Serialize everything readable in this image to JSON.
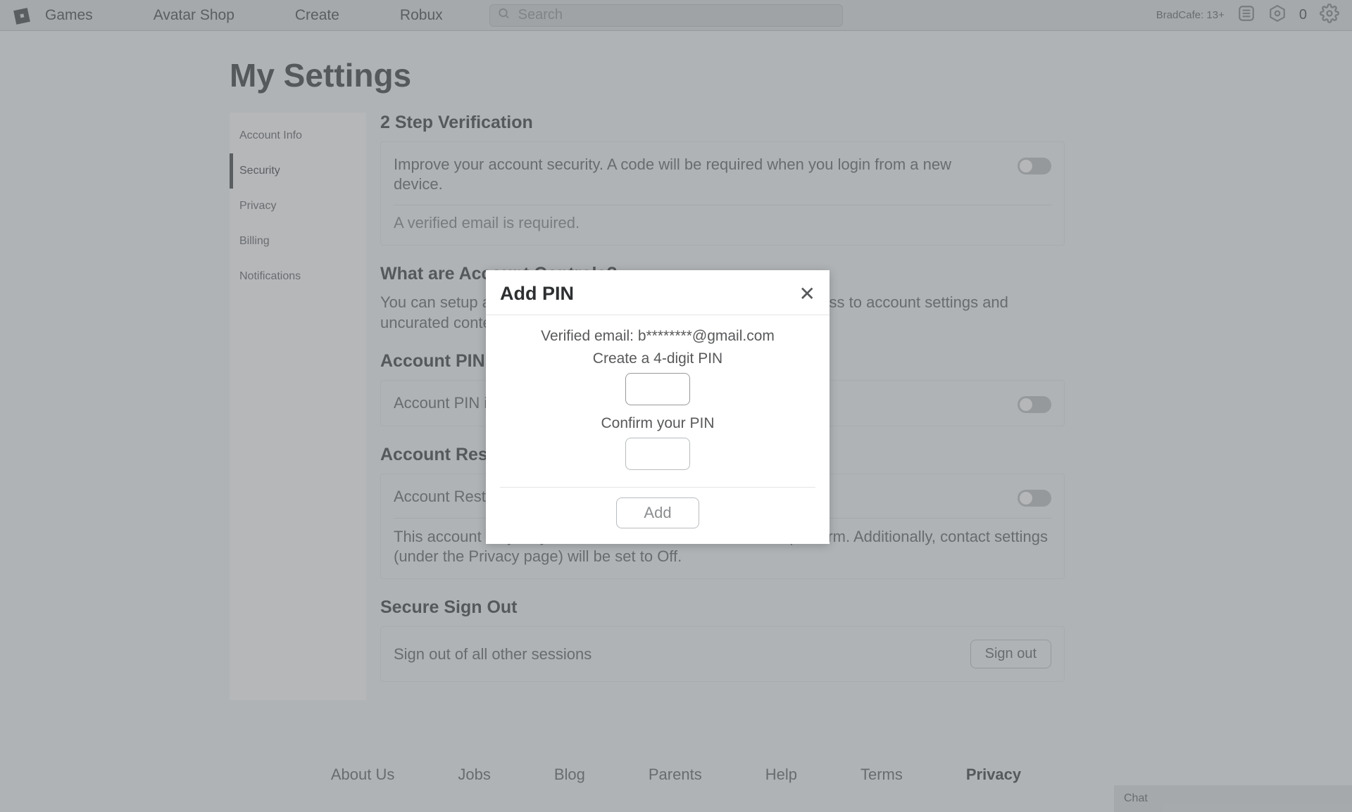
{
  "nav": {
    "links": [
      "Games",
      "Avatar Shop",
      "Create",
      "Robux"
    ],
    "search_placeholder": "Search",
    "username": "BradCafe: 13+",
    "robux": "0"
  },
  "page_title": "My Settings",
  "sidebar": {
    "items": [
      {
        "label": "Account Info"
      },
      {
        "label": "Security"
      },
      {
        "label": "Privacy"
      },
      {
        "label": "Billing"
      },
      {
        "label": "Notifications"
      }
    ],
    "active_index": 1
  },
  "sections": {
    "two_step": {
      "heading": "2 Step Verification",
      "text": "Improve your account security. A code will be required when you login from a new device.",
      "subtext": "A verified email is required."
    },
    "what_are": {
      "heading": "What are Account Controls?",
      "text_part1": "You can setup account restrictions on this account to restrict access to account settings and uncurated content."
    },
    "account_pin": {
      "heading": "Account PIN",
      "text": "Account PIN is currently disabled"
    },
    "account_restrictions": {
      "heading": "Account Restrictions",
      "text": "Account Restrictions is currently disabled",
      "subtext_part1": "This account may only access our curated content on the platform. Additionally, contact settings (under the ",
      "privacy_label": "Privacy",
      "subtext_part2": " page) will be set to Off."
    },
    "secure_sign_out": {
      "heading": "Secure Sign Out",
      "text": "Sign out of all other sessions",
      "button": "Sign out"
    }
  },
  "modal": {
    "title": "Add PIN",
    "verified_email_line": "Verified email: b********@gmail.com",
    "create_label": "Create a 4-digit PIN",
    "confirm_label": "Confirm your PIN",
    "add_button": "Add"
  },
  "footer": {
    "links": [
      "About Us",
      "Jobs",
      "Blog",
      "Parents",
      "Help",
      "Terms",
      "Privacy"
    ]
  },
  "chat_label": "Chat"
}
